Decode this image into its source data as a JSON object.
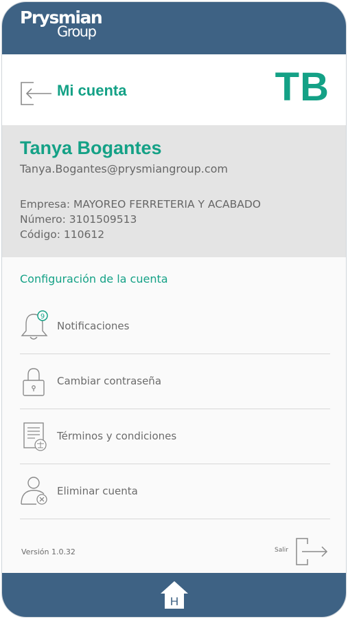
{
  "brand": {
    "line1": "Prysmian",
    "line2": "Group"
  },
  "header": {
    "title": "Mi cuenta",
    "initials": "TB"
  },
  "profile": {
    "name": "Tanya Bogantes",
    "email": "Tanya.Bogantes@prysmiangroup.com",
    "company": "Empresa: MAYOREO FERRETERIA Y ACABADO",
    "number": "Número: 3101509513",
    "code": "Código: 110612"
  },
  "settings": {
    "title": "Configuración de la cuenta",
    "items": [
      {
        "label": "Notificaciones",
        "icon": "bell-icon",
        "badge": "9"
      },
      {
        "label": "Cambiar contraseña",
        "icon": "lock-icon"
      },
      {
        "label": "Términos y condiciones",
        "icon": "document-icon"
      },
      {
        "label": "Eliminar cuenta",
        "icon": "delete-user-icon"
      }
    ]
  },
  "footer": {
    "version": "Versión 1.0.32",
    "logout": "Salir"
  },
  "nav": {
    "home_letter": "H",
    "home_icon": "home-icon"
  },
  "colors": {
    "brand_blue": "#3e6284",
    "accent_green": "#14a186",
    "panel_gray": "#e4e4e4"
  }
}
